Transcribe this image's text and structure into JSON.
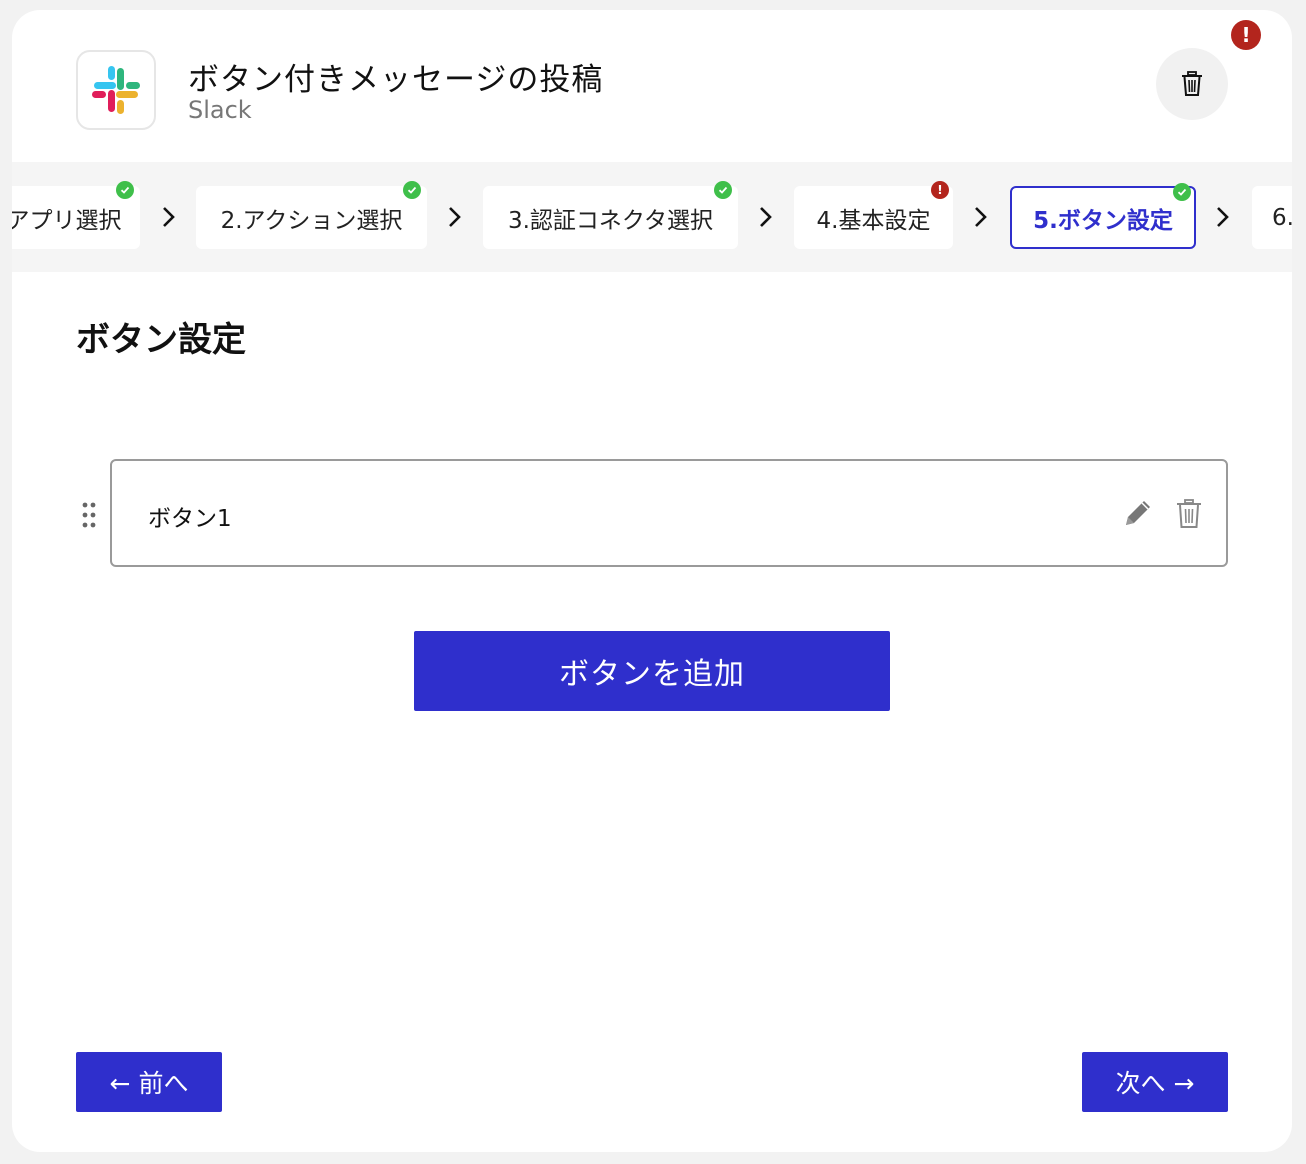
{
  "header": {
    "title": "ボタン付きメッセージの投稿",
    "subtitle": "Slack",
    "app_icon": "slack-logo",
    "delete_icon": "trash-icon",
    "error_badge": "!"
  },
  "stepper": {
    "steps": [
      {
        "label": "アプリ選択",
        "status": "ok"
      },
      {
        "label": "2.アクション選択",
        "status": "ok"
      },
      {
        "label": "3.認証コネクタ選択",
        "status": "ok"
      },
      {
        "label": "4.基本設定",
        "status": "error",
        "mark": "!"
      },
      {
        "label": "5.ボタン設定",
        "status": "ok",
        "active": true
      },
      {
        "label": "6."
      }
    ]
  },
  "section": {
    "title": "ボタン設定",
    "buttons": [
      {
        "label": "ボタン1"
      }
    ],
    "add_button_label": "ボタンを追加"
  },
  "footer": {
    "prev_label": "← 前へ",
    "next_label": "次へ →"
  },
  "colors": {
    "primary": "#2f2fcc",
    "ok": "#3fbf4a",
    "error": "#b3251d"
  }
}
